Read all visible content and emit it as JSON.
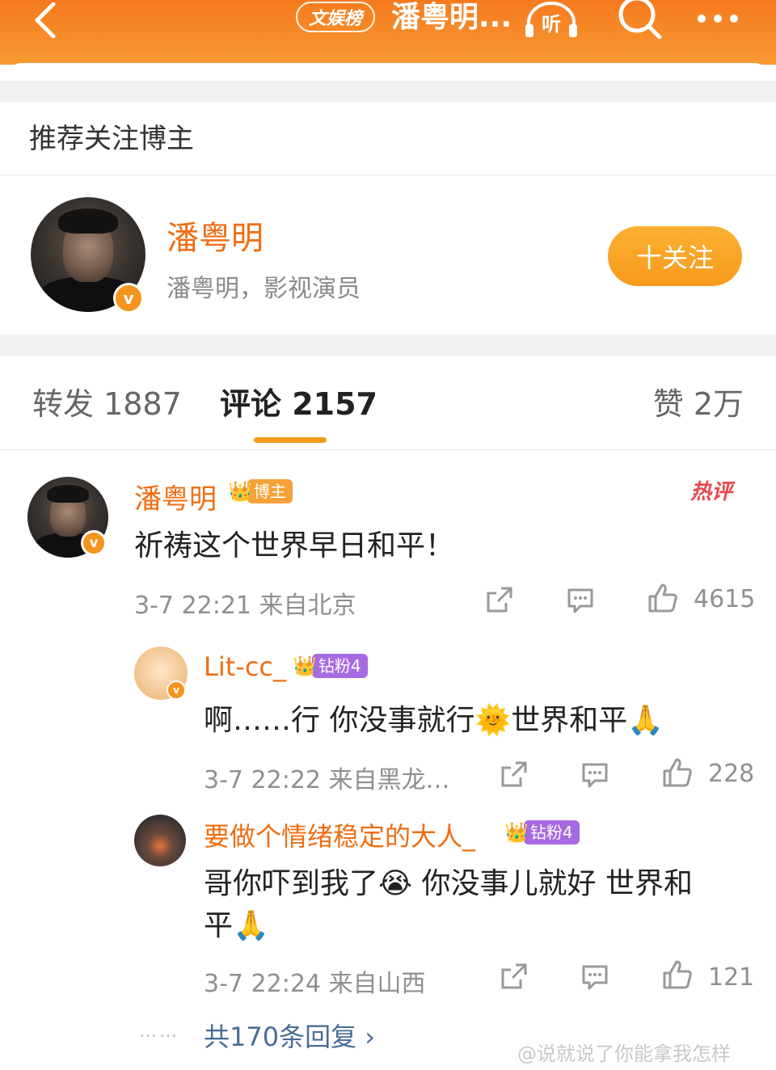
{
  "header": {
    "badge": "文娱榜",
    "title": "潘粤明...",
    "listen_label": "听"
  },
  "recommend": {
    "section_title": "推荐关注博主",
    "name": "潘粤明",
    "description": "潘粤明，影视演员",
    "follow_label": "十关注"
  },
  "tabs": {
    "repost": "转发 1887",
    "comment": "评论 2157",
    "like": "赞 2万"
  },
  "comments": [
    {
      "name": "潘粤明",
      "tag": "博主",
      "hot_label": "热评",
      "text": "祈祷这个世界早日和平！",
      "meta": "3-7 22:21  来自北京",
      "likes": "4615",
      "v_label": "v"
    }
  ],
  "replies": [
    {
      "name": "Lit-cc_",
      "tag": "钻粉4",
      "text": "啊……行 你没事就行🌞世界和平🙏",
      "meta": "3-7 22:22  来自黑龙…",
      "likes": "228",
      "v_label": "v"
    },
    {
      "name": "要做个情绪稳定的大人_",
      "tag": "钻粉4",
      "text_line1": "哥你吓到我了😭 你没事儿就好 世界和",
      "text_line2": "平🙏",
      "meta": "3-7 22:24  来自山西",
      "likes": "121"
    }
  ],
  "more_replies": "共170条回复 ›",
  "dots": "……",
  "watermark": "@说就说了你能拿我怎样",
  "colors": {
    "brand_orange": "#f57a1d",
    "name_orange": "#f06d12",
    "link_blue": "#4a6d95",
    "vip_purple": "#a86ae0"
  }
}
